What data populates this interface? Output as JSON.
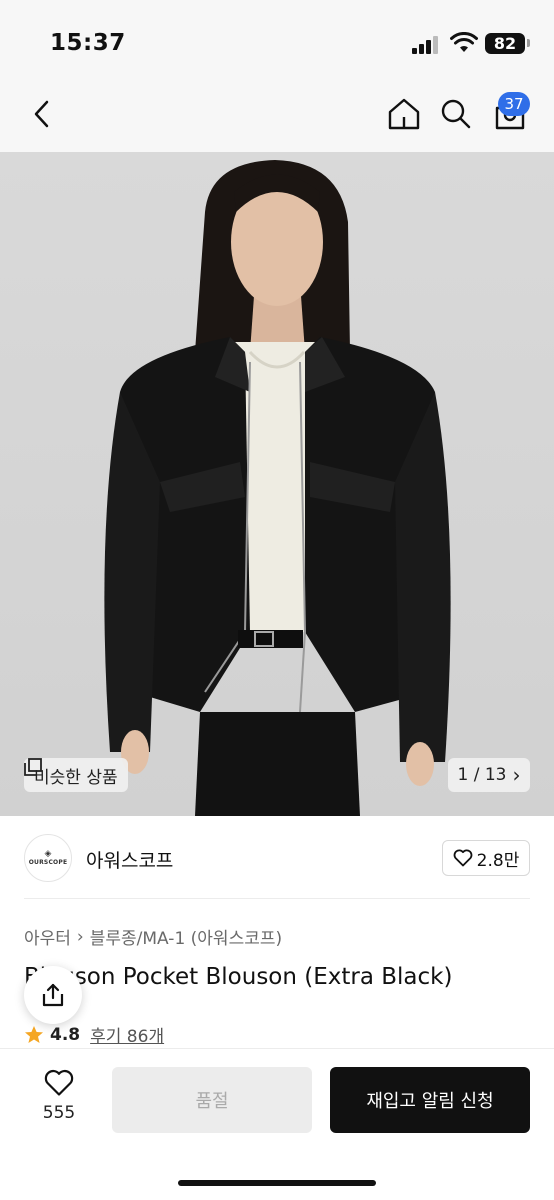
{
  "status_bar": {
    "time": "15:37",
    "battery": "82"
  },
  "nav": {
    "cart_count": "37"
  },
  "hero": {
    "similar_label": "비슷한 상품",
    "pager": "1 / 13",
    "pager_arrow": "›"
  },
  "brand": {
    "logo_text": "OURSCOPE",
    "name": "아워스코프",
    "likes": "2.8만"
  },
  "breadcrumb": {
    "category": "아우터",
    "separator": "›",
    "subcategory": "블루종/MA-1 (아워스코프)"
  },
  "product": {
    "title": "Blouson Pocket Blouson (Extra Black)"
  },
  "rating": {
    "value": "4.8",
    "review_label": "후기 86개"
  },
  "bottom": {
    "wish_count": "555",
    "soldout_label": "품절",
    "restock_label": "재입고 알림 신청"
  },
  "colors": {
    "accent": "#2f6ee8",
    "star": "#f5a623",
    "primary_button": "#111111",
    "disabled_button": "#ececec"
  }
}
